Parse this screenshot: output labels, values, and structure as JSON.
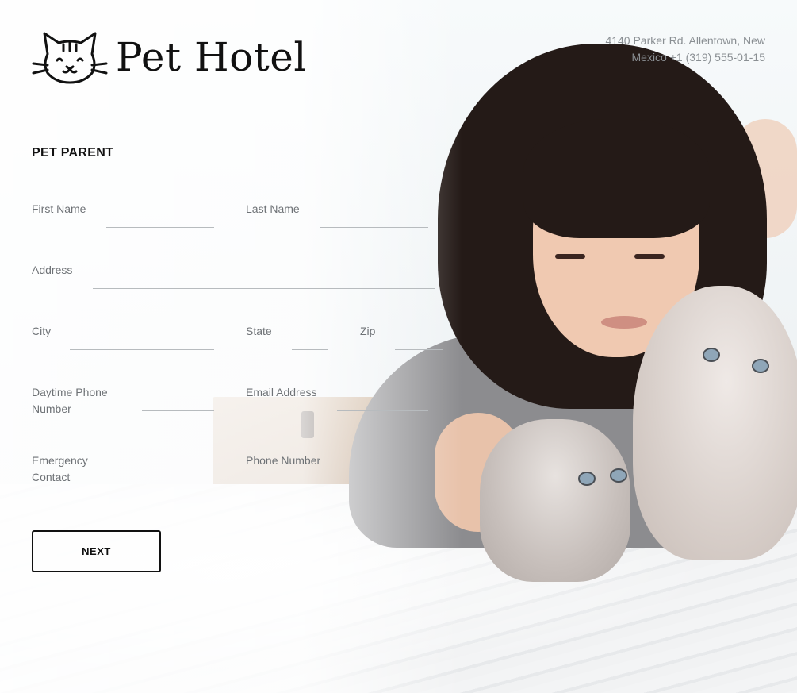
{
  "brand": {
    "name": "Pet Hotel",
    "logo_icon": "cat-face-icon"
  },
  "contact": {
    "address": "4140 Parker Rd. Allentown, New Mexico +1 (319) 555-01-15"
  },
  "form": {
    "section_title": "PET PARENT",
    "fields": {
      "first_name": {
        "label": "First Name",
        "value": ""
      },
      "last_name": {
        "label": "Last Name",
        "value": ""
      },
      "address": {
        "label": "Address",
        "value": ""
      },
      "city": {
        "label": "City",
        "value": ""
      },
      "state": {
        "label": "State",
        "value": ""
      },
      "zip": {
        "label": "Zip",
        "value": ""
      },
      "daytime_phone": {
        "label": "Daytime Phone Number",
        "value": ""
      },
      "email": {
        "label": "Email Address",
        "value": ""
      },
      "emergency_contact": {
        "label": "Emergency Contact",
        "value": ""
      },
      "phone_number": {
        "label": "Phone Number",
        "value": ""
      }
    },
    "next_label": "NEXT"
  }
}
